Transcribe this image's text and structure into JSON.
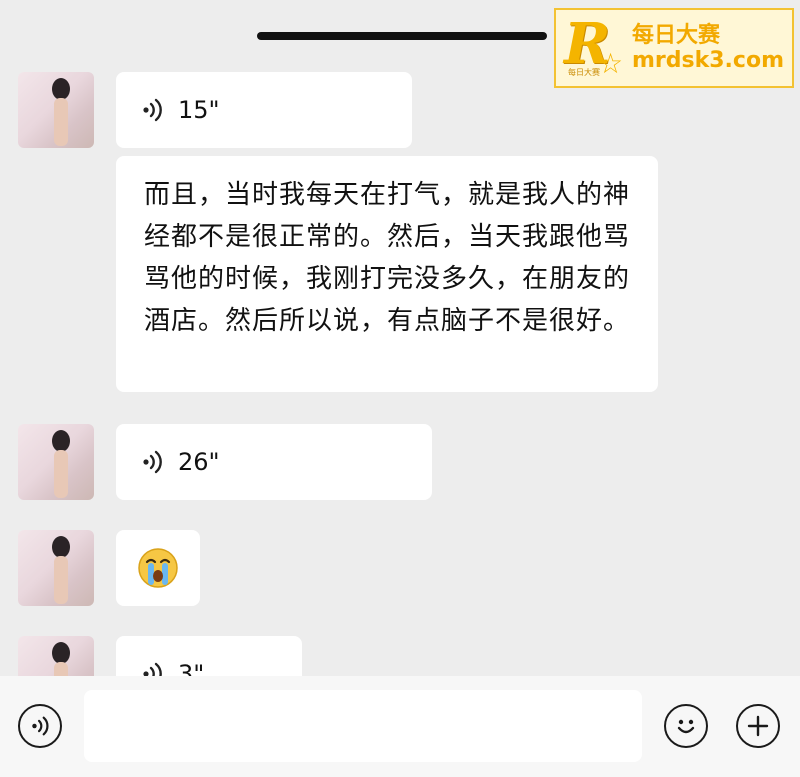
{
  "watermark": {
    "name": "每日大赛",
    "url": "mrdsk3.com",
    "logo_small_text": "每日大赛"
  },
  "messages": [
    {
      "type": "voice",
      "duration": "15\""
    },
    {
      "type": "text",
      "content": "而且，当时我每天在打气，就是我人的神经都不是很正常的。然后，当天我跟他骂骂他的时候，我刚打完没多久，在朋友的酒店。然后所以说，有点脑子不是很好。"
    },
    {
      "type": "voice",
      "duration": "26\""
    },
    {
      "type": "emoji",
      "emoji": "😭"
    },
    {
      "type": "voice",
      "duration": "3\""
    }
  ],
  "input": {
    "value": "",
    "placeholder": ""
  },
  "icons": {
    "voice_toggle": "voice-icon",
    "emoji_button": "smile-icon",
    "more_button": "plus-icon"
  }
}
